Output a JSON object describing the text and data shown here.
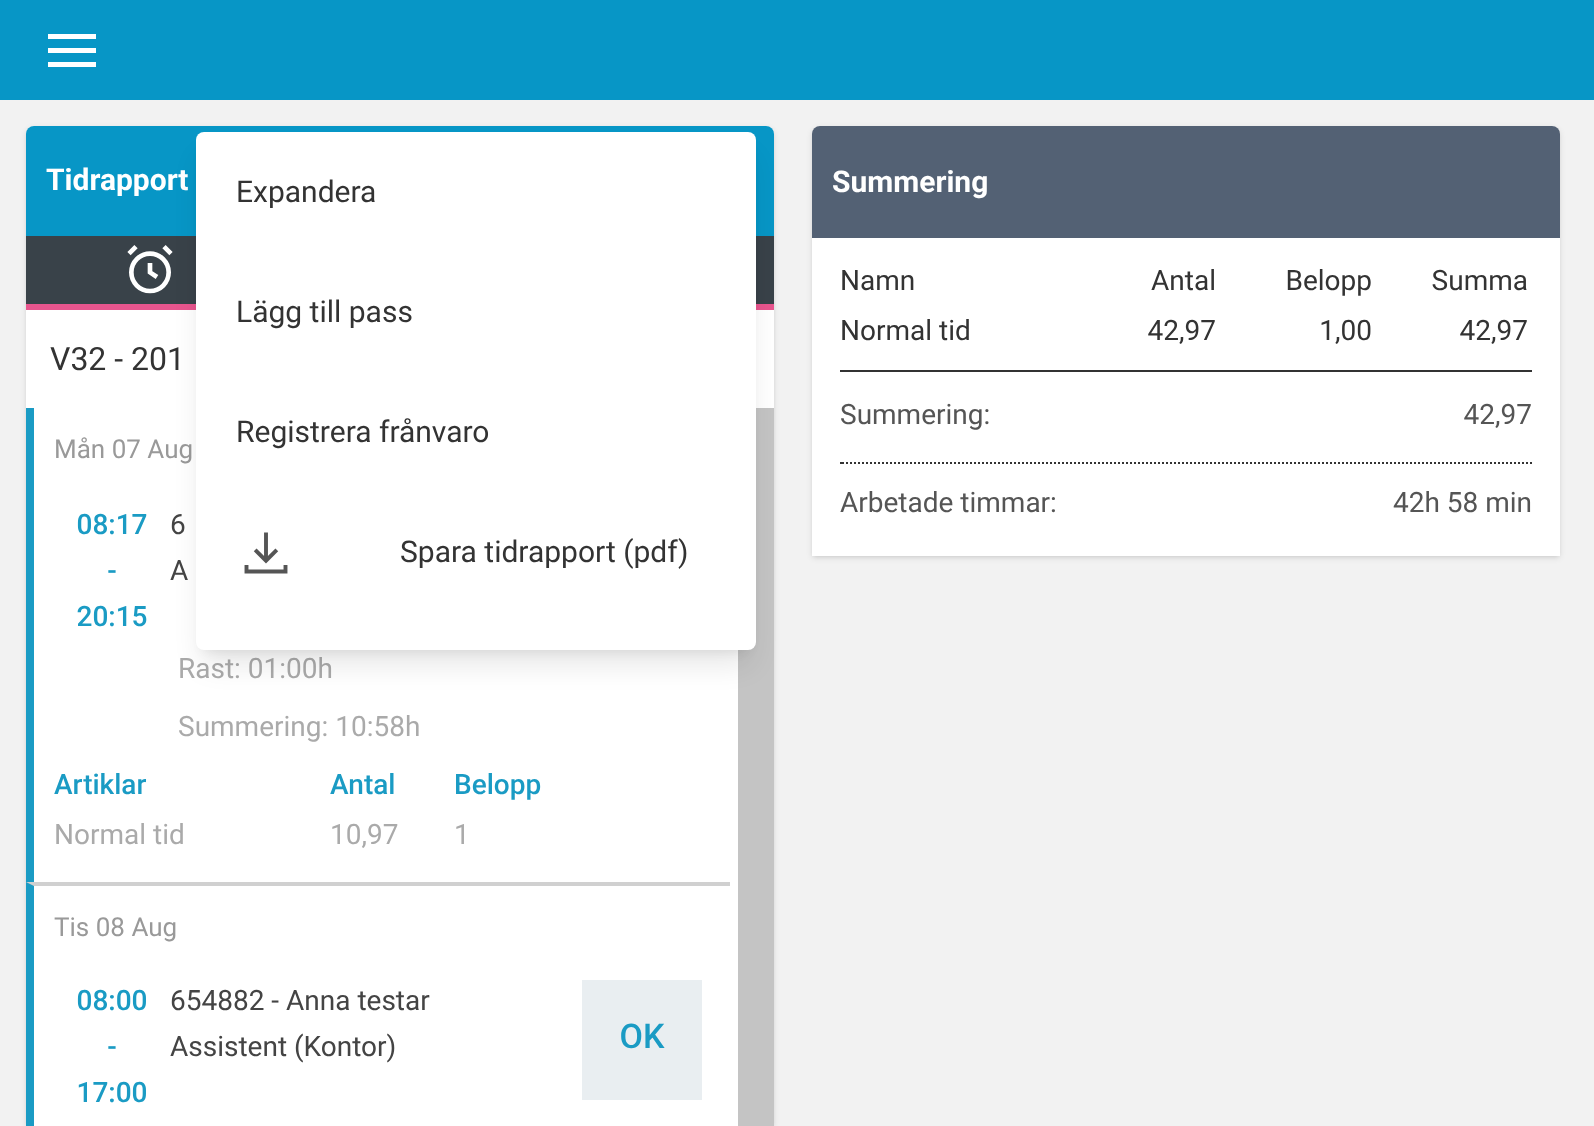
{
  "left_card": {
    "title": "Tidrapport",
    "week": "V32 - 201",
    "days": [
      {
        "date": "Mån 07 Aug",
        "start": "08:17",
        "sep": "-",
        "end": "20:15",
        "line_1": "6",
        "line_2": "A",
        "break": "Rast: 01:00h",
        "summary": "Summering: 10:58h",
        "articles": {
          "columns": [
            "Artiklar",
            "Antal",
            "Belopp"
          ],
          "rows": [
            [
              "Normal tid",
              "10,97",
              "1"
            ]
          ]
        }
      },
      {
        "date": "Tis 08 Aug",
        "start": "08:00",
        "sep": "-",
        "end": "17:00",
        "line_1": "654882 - Anna testar",
        "line_2": "Assistent (Kontor)",
        "ok": "OK"
      }
    ]
  },
  "menu": [
    {
      "label": "Expandera",
      "kind": "text"
    },
    {
      "label": "Lägg till pass",
      "kind": "text"
    },
    {
      "label": "Registrera frånvaro",
      "kind": "text"
    },
    {
      "label": "Spara tidrapport (pdf)",
      "kind": "download"
    }
  ],
  "summary_card": {
    "title": "Summering",
    "columns": [
      "Namn",
      "Antal",
      "Belopp",
      "Summa"
    ],
    "rows": [
      [
        "Normal tid",
        "42,97",
        "1,00",
        "42,97"
      ]
    ],
    "total_label": "Summering:",
    "total_value": "42,97",
    "hours_label": "Arbetade timmar:",
    "hours_value": "42h 58 min"
  }
}
